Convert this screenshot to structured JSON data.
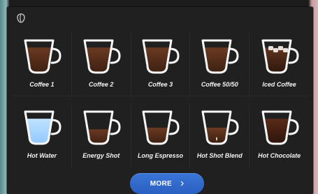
{
  "header": {
    "icon": "coffee-bean-icon"
  },
  "drinks": [
    {
      "label": "Coffee 1",
      "fill": "coffee",
      "level": 0.78
    },
    {
      "label": "Coffee 2",
      "fill": "coffee",
      "level": 0.78
    },
    {
      "label": "Coffee 3",
      "fill": "coffee",
      "level": 0.78
    },
    {
      "label": "Coffee 50/50",
      "fill": "coffee",
      "level": 0.78
    },
    {
      "label": "Iced Coffee",
      "fill": "iced",
      "level": 0.78
    },
    {
      "label": "Hot Water",
      "fill": "water",
      "level": 0.78
    },
    {
      "label": "Energy Shot",
      "fill": "coffee",
      "level": 0.45
    },
    {
      "label": "Long Espresso",
      "fill": "coffee",
      "level": 0.5
    },
    {
      "label": "Hot Shot Blend",
      "fill": "blend",
      "level": 0.5
    },
    {
      "label": "Hot Chocolate",
      "fill": "chocolate",
      "level": 0.78
    }
  ],
  "footer": {
    "more_label": "MORE"
  },
  "colors": {
    "coffee": "#6a3a22",
    "coffee_dark": "#3e2012",
    "water": "#bfe3ff",
    "chocolate": "#5a2a18",
    "accent": "#2f66cc"
  }
}
